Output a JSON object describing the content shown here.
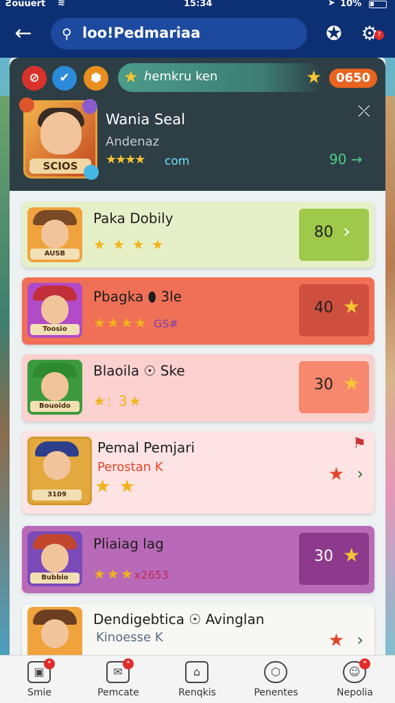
{
  "status_bar": {
    "carrier": "Ƨouuert",
    "time": "15:34",
    "battery": "10%"
  },
  "header": {
    "search_query": "loo!Pedmariaa"
  },
  "profile": {
    "quest_label": "ℎemkru ken",
    "coin_value": "0650",
    "name": "Wania Seal",
    "subtitle": "Andenaz",
    "avatar_plate": "SCIOS",
    "stars_text": "com",
    "score": "90 →"
  },
  "cards": [
    {
      "title": "Paka Dobily",
      "rating": "★ ★ ★ ★",
      "extra": "",
      "thumb_caption": "AUSB",
      "score": "80",
      "action_icon": "chevron-right-icon"
    },
    {
      "title": "Pbagka ⬮ 3le",
      "rating": "★★★★",
      "extra": "GS#",
      "thumb_caption": "Toosio",
      "score": "40",
      "action_icon": "star-icon"
    },
    {
      "title": "Blaoila ☉ Ske",
      "rating": "★: 3★",
      "extra": "",
      "thumb_caption": "Bouoido",
      "score": "30",
      "action_icon": "star-icon"
    },
    {
      "title": "Pemal Pemjari",
      "subtitle": "Perostan K",
      "rating": "★ ★",
      "extra": "",
      "thumb_caption": "3109",
      "score": "",
      "action_icon": "star-icon"
    },
    {
      "title": "Pliaiag lag",
      "rating": "★★★",
      "extra": "x2653",
      "thumb_caption": "Bubbio",
      "score": "30",
      "action_icon": "star-icon"
    },
    {
      "title": "Dendigebtica ☉ Avinglan",
      "subtitle": "Kinoesse K",
      "rating": "★★★★",
      "extra": "",
      "thumb_caption": "",
      "score": "",
      "action_icon": "star-icon"
    }
  ],
  "bottom_nav": [
    {
      "label": "Smie",
      "badge": "*"
    },
    {
      "label": "Pemcate",
      "badge": "*"
    },
    {
      "label": "Renqkis",
      "badge": ""
    },
    {
      "label": "Penentes",
      "badge": ""
    },
    {
      "label": "Nepolia",
      "badge": "*"
    }
  ]
}
